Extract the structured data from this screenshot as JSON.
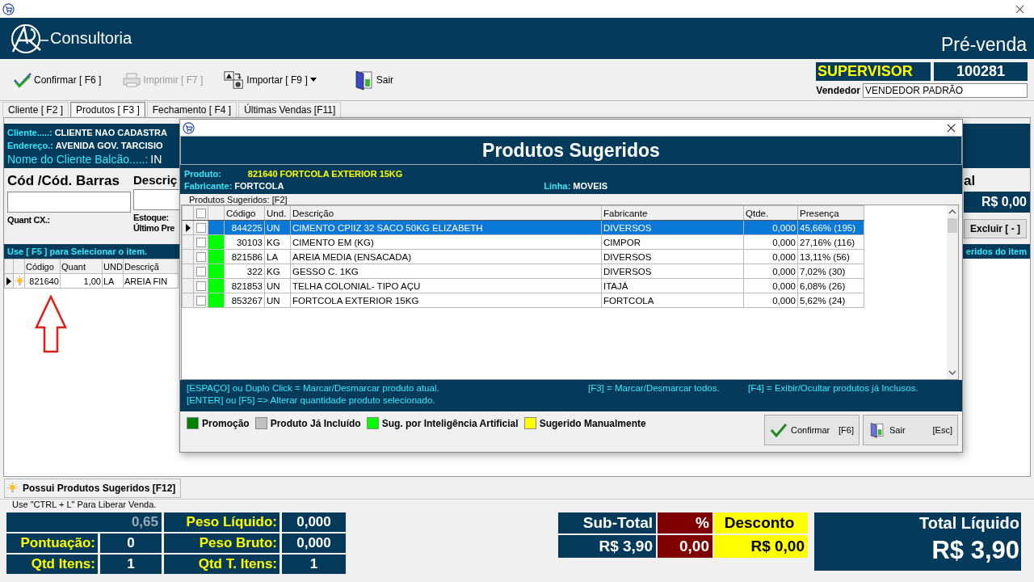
{
  "header": {
    "brand": "Consultoria",
    "module": "Pré-venda"
  },
  "toolbar": [
    {
      "kind": "confirm",
      "label": "Confirmar [ F6 ]",
      "disabled": false,
      "dropdown": false
    },
    {
      "kind": "print",
      "label": "Imprimir  [ F7 ]",
      "disabled": true,
      "dropdown": false
    },
    {
      "kind": "import",
      "label": "Importar [ F9 ]",
      "disabled": false,
      "dropdown": true
    },
    {
      "kind": "exit",
      "label": "Sair",
      "disabled": false,
      "dropdown": false
    }
  ],
  "user": {
    "role": "SUPERVISOR",
    "code": "100281",
    "seller_label": "Vendedor",
    "seller": "VENDEDOR PADRÃO"
  },
  "tabs": [
    {
      "label": "Cliente [ F2 ]",
      "selected": false
    },
    {
      "label": "Produtos [ F3 ]",
      "selected": true
    },
    {
      "label": "Fechamento [ F4 ]",
      "selected": false
    },
    {
      "label": "Últimas Vendas [F11]",
      "selected": false
    }
  ],
  "customer": [
    {
      "kind": "normal",
      "label": "Cliente.....:",
      "value": "CLIENTE NAO CADASTRA"
    },
    {
      "kind": "normal",
      "label": "Endereço.:",
      "value": "AVENIDA GOV. TARCISIO"
    },
    {
      "kind": "large",
      "label": "Nome do Cliente Balcão.....:",
      "value": "IN"
    }
  ],
  "entry": {
    "code_label": "Cód /Cód. Barras",
    "desc_label": "Descriç",
    "quant_label": "Quant CX.:",
    "stock_label": "Estoque:",
    "last_price_label": "Último Pre",
    "total_label": "al",
    "total_value": "R$ 0,00",
    "delete_button": "Excluir [ - ]"
  },
  "items_bar": {
    "hint": "Use [ F5 ] para Selecionar o item.",
    "right": "eridos do item"
  },
  "items": {
    "columns": [
      "Código",
      "Quant",
      "UND",
      "Descriçã"
    ],
    "rows": [
      {
        "selected": true,
        "suggested": true,
        "cells": [
          "821640",
          "1,00",
          "LA",
          "AREIA FIN"
        ]
      }
    ]
  },
  "suggest_button": "Possui Produtos Sugeridos [F12]",
  "release_hint": "Use \"CTRL + L\" Para Liberar Venda.",
  "stats": {
    "balance": "0,65",
    "left": [
      {
        "label": "Pontuação:",
        "value": "0"
      },
      {
        "label": "Qtd Itens:",
        "value": "1"
      }
    ],
    "right": [
      {
        "label": "Peso Líquido:",
        "value": "0,000"
      },
      {
        "label": "Peso Bruto:",
        "value": "0,000"
      },
      {
        "label": "Qtd T. Itens:",
        "value": "1"
      }
    ]
  },
  "totals": {
    "subtotal_label": "Sub-Total",
    "subtotal": "R$ 3,90",
    "percent_label": "%",
    "percent": "0,00",
    "discount_label": "Desconto",
    "discount": "R$ 0,00",
    "total_label": "Total Líquido",
    "total": "R$ 3,90"
  },
  "dialog": {
    "title": "Produtos Sugeridos",
    "product_label": "Produto:",
    "product": "821640 FORTCOLA EXTERIOR 15KG",
    "maker_label": "Fabricante:",
    "maker": "FORTCOLA",
    "line_label": "Linha:",
    "line": "MOVEIS",
    "group": "Produtos Sugeridos: [F2]",
    "all_checked": false,
    "columns": [
      "Código",
      "Und.",
      "Descrição",
      "Fabricante",
      "Qtde.",
      "Presença"
    ],
    "rows": [
      {
        "selected": true,
        "checked": false,
        "cells": [
          "844225",
          "UN",
          "CIMENTO CPIIZ 32 SACO 50KG ELIZABETH",
          "DIVERSOS",
          "0,000",
          "45,66% (195)"
        ]
      },
      {
        "selected": false,
        "checked": false,
        "color": "#00ff00",
        "cells": [
          "30103",
          "KG",
          "CIMENTO EM (KG)",
          "CIMPOR",
          "0,000",
          "27,16% (116)"
        ]
      },
      {
        "selected": false,
        "checked": false,
        "color": "#00ff00",
        "cells": [
          "821586",
          "LA",
          "AREIA MEDIA (ENSACADA)",
          "DIVERSOS",
          "0,000",
          "13,11% (56)"
        ]
      },
      {
        "selected": false,
        "checked": false,
        "color": "#00ff00",
        "cells": [
          "322",
          "KG",
          "GESSO C. 1KG",
          "DIVERSOS",
          "0,000",
          "7,02% (30)"
        ]
      },
      {
        "selected": false,
        "checked": false,
        "color": "#00ff00",
        "cells": [
          "821853",
          "UN",
          "TELHA COLONIAL- TIPO  AÇU",
          "ITAJÁ",
          "0,000",
          "6,08% (26)"
        ]
      },
      {
        "selected": false,
        "checked": false,
        "color": "#00ff00",
        "cells": [
          "853267",
          "UN",
          "FORTCOLA EXTERIOR 15KG",
          "FORTCOLA",
          "0,000",
          "5,62% (24)"
        ]
      }
    ],
    "help": {
      "left": [
        "[ESPAÇO] ou Duplo Click = Marcar/Desmarcar produto atual.",
        "[ENTER] ou [F5] => Alterar quantidade produto selecionado."
      ],
      "middle": "[F3] = Marcar/Desmarcar todos.",
      "right": "[F4] = Exibir/Ocultar produtos já Inclusos."
    },
    "legend": [
      {
        "label": "Promoção",
        "color": "#008000"
      },
      {
        "label": "Produto Já Incluído",
        "color": "#c0c0c0"
      },
      {
        "label": "Sug. por Inteligência Artificial",
        "color": "#00ff00"
      },
      {
        "label": "Sugerido Manualmente",
        "color": "#ffff00"
      }
    ],
    "buttons": [
      {
        "kind": "confirm",
        "label": "Confirmar",
        "key": "[F6]"
      },
      {
        "kind": "exit",
        "label": "Sair",
        "key": "[Esc]"
      }
    ]
  }
}
